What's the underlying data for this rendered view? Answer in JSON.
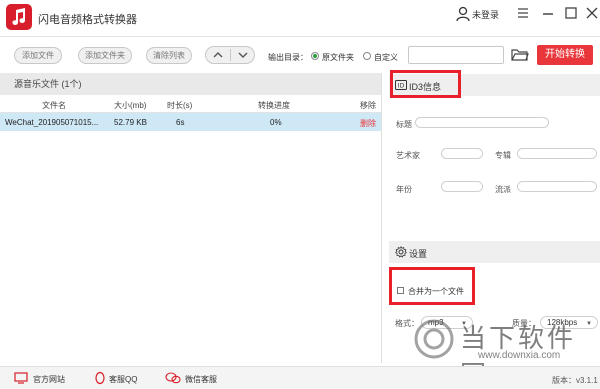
{
  "app": {
    "title": "闪电音频格式转换器"
  },
  "window": {
    "user_label": "未登录"
  },
  "toolbar": {
    "add_file": "添加文件",
    "add_folder": "添加文件夹",
    "clear_list": "清除列表",
    "output_label": "输出目录：",
    "radio_original": "原文件夹",
    "radio_custom": "自定义",
    "output_path": "",
    "start_button": "开始转换"
  },
  "file_list": {
    "header": "源音乐文件 (1个)",
    "columns": [
      "文件名",
      "大小(mb)",
      "时长(s)",
      "转换进度",
      "移除"
    ],
    "rows": [
      {
        "name": "WeChat_201905071015...",
        "size": "52.79 KB",
        "duration": "6s",
        "progress": "0%",
        "remove": "删除"
      }
    ]
  },
  "id3": {
    "title": "ID3信息",
    "fields": {
      "title_label": "标题",
      "artist_label": "艺术家",
      "album_label": "专辑",
      "year_label": "年份",
      "genre_label": "流派"
    }
  },
  "settings": {
    "title": "设置",
    "merge_label": "合并为一个文件",
    "merge_checked": false,
    "format_label": "格式：",
    "format_value": "mp3",
    "quality_label": "质量：",
    "quality_value": "128kbps"
  },
  "footer": {
    "website": "官方网站",
    "qq_support": "客服QQ",
    "wechat_support": "微信客服",
    "version": "版本：v3.1.1"
  },
  "watermark": {
    "text": "当下软件园",
    "url": "www.downxia.com"
  },
  "colors": {
    "accent": "#e8363a",
    "highlight": "#e8202a",
    "selected_row": "#cfe8f6"
  }
}
